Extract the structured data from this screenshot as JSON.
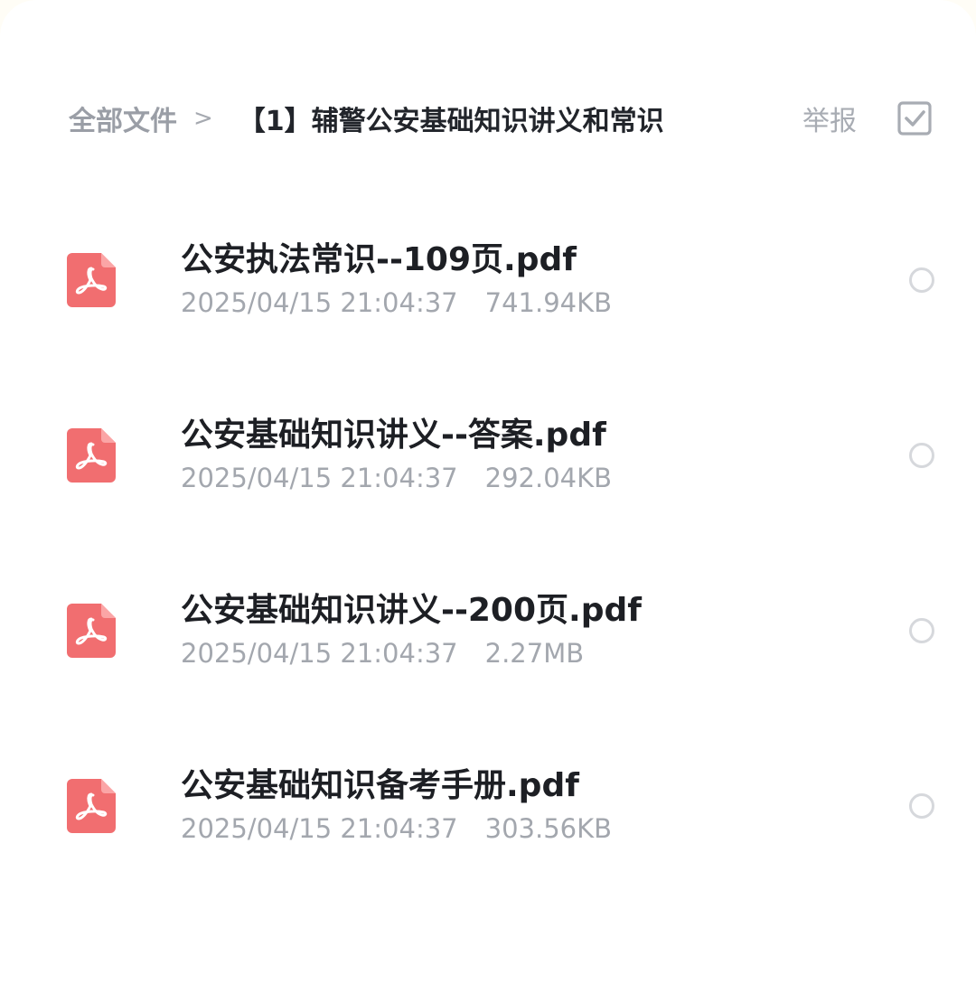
{
  "header": {
    "breadcrumb_root": "全部文件",
    "breadcrumb_separator": ">",
    "breadcrumb_current": "【1】辅警公安基础知识讲义和常识",
    "report_label": "举报",
    "select_icon": "checkbox-icon"
  },
  "colors": {
    "pdf_icon": "#f16e70",
    "title_text": "#1d1f24",
    "meta_text": "#a3a7ae"
  },
  "files": [
    {
      "name": "公安执法常识--109页.pdf",
      "date": "2025/04/15 21:04:37",
      "size": "741.94KB",
      "icon": "pdf-icon"
    },
    {
      "name": "公安基础知识讲义--答案.pdf",
      "date": "2025/04/15 21:04:37",
      "size": "292.04KB",
      "icon": "pdf-icon"
    },
    {
      "name": "公安基础知识讲义--200页.pdf",
      "date": "2025/04/15 21:04:37",
      "size": "2.27MB",
      "icon": "pdf-icon"
    },
    {
      "name": "公安基础知识备考手册.pdf",
      "date": "2025/04/15 21:04:37",
      "size": "303.56KB",
      "icon": "pdf-icon"
    }
  ]
}
